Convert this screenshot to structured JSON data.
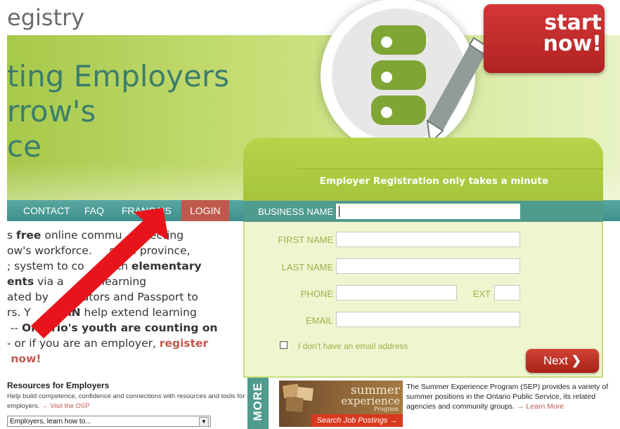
{
  "site": {
    "logo_text": "egistry"
  },
  "hero": {
    "title_lines": [
      "ting Employers",
      "rrow's",
      "ce"
    ]
  },
  "nav": {
    "items": [
      "CONTACT",
      "FAQ",
      "FRANÇAIS"
    ],
    "login": "LOGIN"
  },
  "intro": {
    "line1_pre": "s ",
    "line1_bold": "free",
    "line1_post": " online commu    nnecting",
    "line2": "ow's workforce.     s the province,",
    "line3_pre": "; system to co      with ",
    "line3_bold": "elementary",
    "line4_bold": "ents",
    "line4_post": " via a       of learning",
    "line5": "ated by        cators and Passport to",
    "line6_pre": "rs. Y       ",
    "line6_bold": "CAN",
    "line6_post": " help extend learning",
    "line7_pre": " -- ",
    "line7_bold": "Ontario's youth are counting on",
    "line8_pre": "- or if you are an employer, ",
    "line8_red": "register",
    "line9_red": " now!"
  },
  "resources": {
    "title": "Resources for Employers",
    "text": "Help build competence, confidence and connections with resources and tools for employers.",
    "link": "→ Visit the OSP",
    "select_value": "Employers, learn how to..."
  },
  "promo": {
    "start_line1": "start",
    "start_line2": "now!"
  },
  "form": {
    "heading": "Employer Registration only takes a minute",
    "business_name_label": "BUSINESS NAME",
    "first_name_label": "FIRST NAME",
    "last_name_label": "LAST NAME",
    "phone_label": "PHONE",
    "ext_label": "EXT",
    "email_label": "EMAIL",
    "no_email_label": "I don't have an email address",
    "next_label": "Next",
    "next_icon": "❯"
  },
  "more": {
    "label": "MORE"
  },
  "sep": {
    "banner_word1": "summer",
    "banner_word2": "experience",
    "banner_word3": "Program",
    "banner_cta": "Search Job Postings →",
    "text": "The Summer Experience Program (SEP) provides a variety of summer positions in the Ontario Public Service, its related agencies and community groups.",
    "link": "→ Learn More"
  },
  "colors": {
    "accent_red": "#c0594d",
    "nav_teal": "#4f9b8d",
    "panel_green": "#a5c43b"
  }
}
